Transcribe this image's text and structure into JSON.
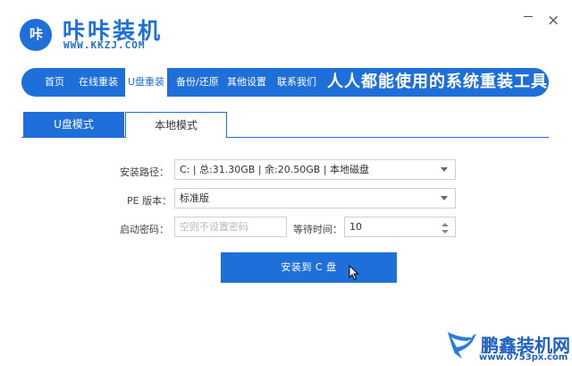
{
  "app": {
    "logo_text": "咔",
    "title": "咔咔装机",
    "url": "WWW.KKZJ.COM",
    "close_glyph": "×"
  },
  "nav": {
    "items": [
      {
        "label": "首页"
      },
      {
        "label": "在线重装"
      },
      {
        "label": "U盘重装",
        "active": true
      },
      {
        "label": "备份/还原"
      },
      {
        "label": "其他设置"
      },
      {
        "label": "联系我们"
      }
    ],
    "slogan": "人人都能使用的系统重装工具"
  },
  "tabs": [
    {
      "label": "U盘模式",
      "active": true
    },
    {
      "label": "本地模式",
      "active": false
    }
  ],
  "form": {
    "install_path_label": "安装路径：",
    "install_path_value": "C: | 总:31.30GB | 余:20.50GB | 本地磁盘",
    "pe_version_label": "PE 版本：",
    "pe_version_value": "标准版",
    "boot_password_label": "启动密码：",
    "boot_password_placeholder": "空则不设置密码",
    "wait_time_label": "等待时间：",
    "wait_time_value": "10"
  },
  "install_button": "安装到 C 盘",
  "watermark": {
    "title": "鹏鑫装机网",
    "url": "www.0753px.com"
  },
  "colors": {
    "accent": "#1e6fd9",
    "watermark": "#1e5fc4"
  }
}
